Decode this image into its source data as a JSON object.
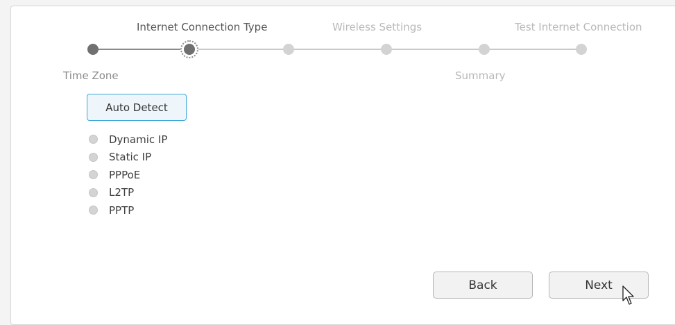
{
  "wizard": {
    "steps": [
      {
        "label": "Time Zone",
        "state": "done"
      },
      {
        "label": "Internet Connection Type",
        "state": "current"
      },
      {
        "label": "Wireless Settings",
        "state": "pending"
      },
      {
        "label": "Test Internet Connection",
        "state": "pending"
      },
      {
        "label": "Summary",
        "state": "pending"
      }
    ]
  },
  "connection": {
    "auto_detect_label": "Auto Detect",
    "options": [
      {
        "label": "Dynamic IP",
        "selected": false
      },
      {
        "label": "Static IP",
        "selected": false
      },
      {
        "label": "PPPoE",
        "selected": false
      },
      {
        "label": "L2TP",
        "selected": false
      },
      {
        "label": "PPTP",
        "selected": false
      }
    ]
  },
  "footer": {
    "back_label": "Back",
    "next_label": "Next"
  },
  "colors": {
    "accent": "#3aa6d8",
    "step_done": "#707070",
    "step_pending": "#d3d3d3"
  },
  "icons": {
    "cursor": "mouse-pointer-icon"
  }
}
